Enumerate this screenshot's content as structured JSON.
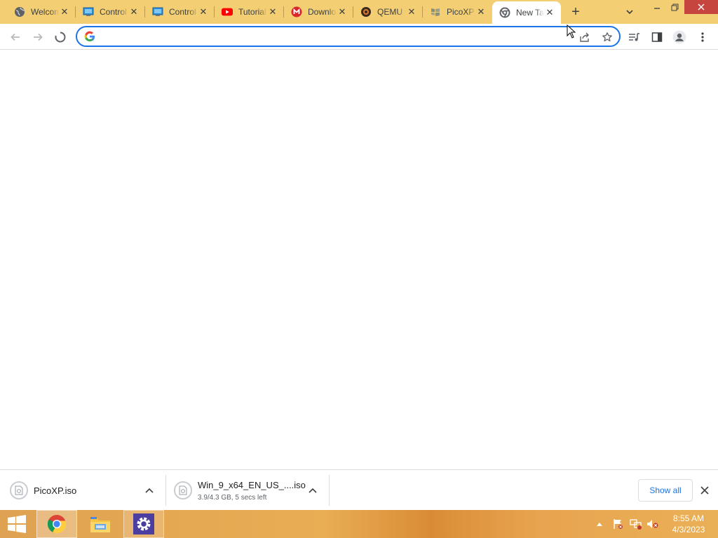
{
  "tabs": [
    {
      "label": "Welcome",
      "icon": "globe-icon"
    },
    {
      "label": "Control Panel",
      "icon": "control-panel-icon"
    },
    {
      "label": "Control Panel",
      "icon": "control-panel-icon"
    },
    {
      "label": "Tutorial",
      "icon": "youtube-icon"
    },
    {
      "label": "Download",
      "icon": "mega-icon"
    },
    {
      "label": "QEMU",
      "icon": "qemu-icon"
    },
    {
      "label": "PicoXP",
      "icon": "picoxp-icon"
    },
    {
      "label": "New Tab",
      "icon": "chrome-newtab-icon",
      "active": true
    }
  ],
  "tabstrip": {
    "new_tab_label": "+"
  },
  "omnibox": {
    "value": "",
    "placeholder": ""
  },
  "downloads": [
    {
      "name": "PicoXP.iso",
      "status": ""
    },
    {
      "name": "Win_9_x64_EN_US_....iso",
      "status": "3.9/4.3 GB, 5 secs left"
    }
  ],
  "shelf": {
    "show_all_label": "Show all"
  },
  "clock": {
    "time": "8:55 AM",
    "date": "4/3/2023"
  },
  "colors": {
    "tabstrip": "#f3ce72",
    "accent": "#1a73e8",
    "close_button": "#c7453f"
  }
}
